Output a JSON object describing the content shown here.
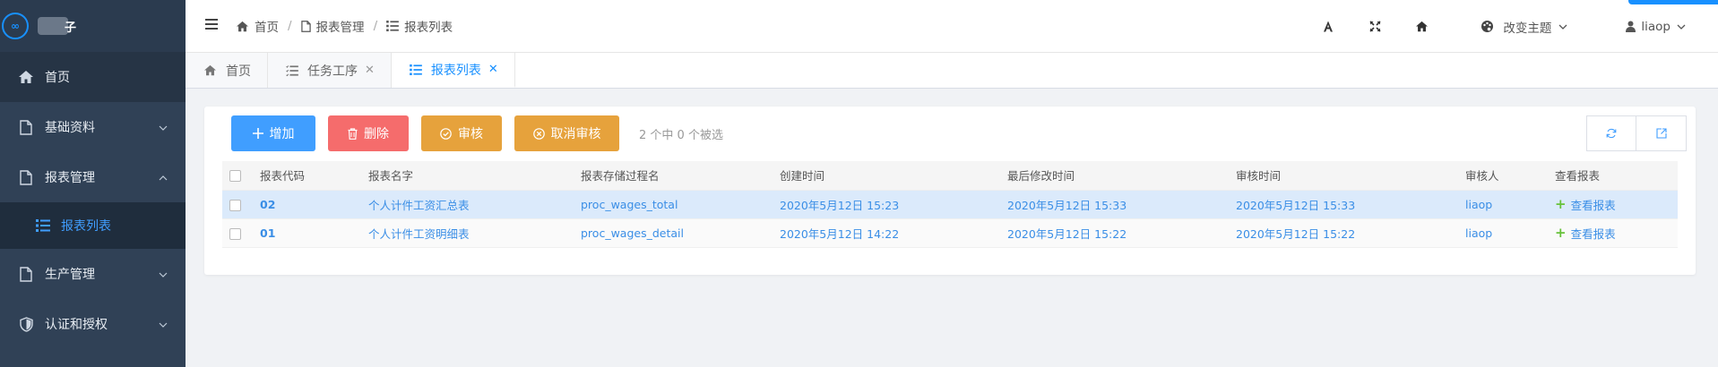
{
  "sidebar": {
    "logo_text": "子",
    "logo_icon": "infinity-icon",
    "items": [
      {
        "label": "首页",
        "icon": "home-icon"
      },
      {
        "label": "基础资料",
        "icon": "document-icon"
      },
      {
        "label": "报表管理",
        "icon": "document-icon"
      },
      {
        "label": "报表列表",
        "icon": "list-icon"
      },
      {
        "label": "生产管理",
        "icon": "document-icon"
      },
      {
        "label": "认证和授权",
        "icon": "shield-icon"
      }
    ]
  },
  "header": {
    "breadcrumb": [
      "首页",
      "报表管理",
      "报表列表"
    ],
    "theme_label": "改变主题",
    "username": "liaop"
  },
  "tabs": [
    {
      "label": "首页"
    },
    {
      "label": "任务工序"
    },
    {
      "label": "报表列表"
    }
  ],
  "toolbar": {
    "add_label": "增加",
    "delete_label": "删除",
    "audit_label": "审核",
    "unaudit_label": "取消审核",
    "selection_info": "2 个中 0 个被选"
  },
  "table": {
    "columns": [
      "报表代码",
      "报表名字",
      "报表存储过程名",
      "创建时间",
      "最后修改时间",
      "审核时间",
      "审核人",
      "查看报表"
    ],
    "rows": [
      {
        "code": "02",
        "name": "个人计件工资汇总表",
        "proc": "proc_wages_total",
        "created": "2020年5月12日 15:23",
        "modified": "2020年5月12日 15:33",
        "audited": "2020年5月12日 15:33",
        "auditor": "liaop",
        "view": "查看报表"
      },
      {
        "code": "01",
        "name": "个人计件工资明细表",
        "proc": "proc_wages_detail",
        "created": "2020年5月12日 14:22",
        "modified": "2020年5月12日 15:22",
        "audited": "2020年5月12日 15:22",
        "auditor": "liaop",
        "view": "查看报表"
      }
    ]
  },
  "colors": {
    "sidebar_bg": "#304156",
    "accent": "#409eff",
    "danger": "#f56c6c",
    "warning": "#e6a23c",
    "success": "#67c23a"
  }
}
